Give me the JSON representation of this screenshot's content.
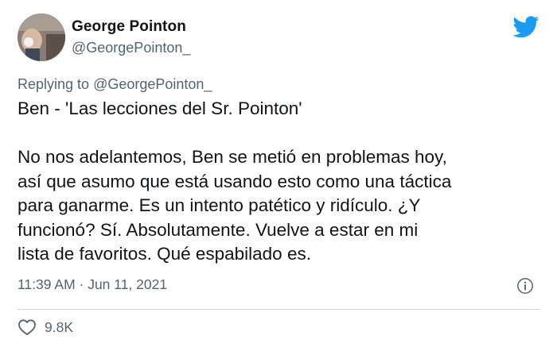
{
  "author": {
    "display_name": "George Pointon",
    "handle": "@GeorgePointon_"
  },
  "reply": {
    "prefix": "Replying to ",
    "mention": "@GeorgePointon_"
  },
  "tweet": {
    "lines": [
      "Ben - 'Las lecciones del Sr. Pointon'",
      "No nos adelantemos, Ben se metió en problemas hoy,",
      "así que asumo que está usando esto como una táctica",
      "para ganarme. Es un intento patético y ridículo. ¿Y",
      "funcionó? Sí. Absolutamente. Vuelve a estar en mi",
      "lista de favoritos. Qué espabilado es."
    ]
  },
  "meta": {
    "timestamp": "11:39 AM · Jun 11, 2021"
  },
  "engagement": {
    "likes": "9.8K"
  },
  "icons": {
    "logo": "twitter-bird-icon",
    "info": "info-icon",
    "like": "heart-icon"
  },
  "colors": {
    "twitter_blue": "#1d9bf0",
    "secondary_text": "#536471",
    "primary_text": "#0f1419"
  }
}
